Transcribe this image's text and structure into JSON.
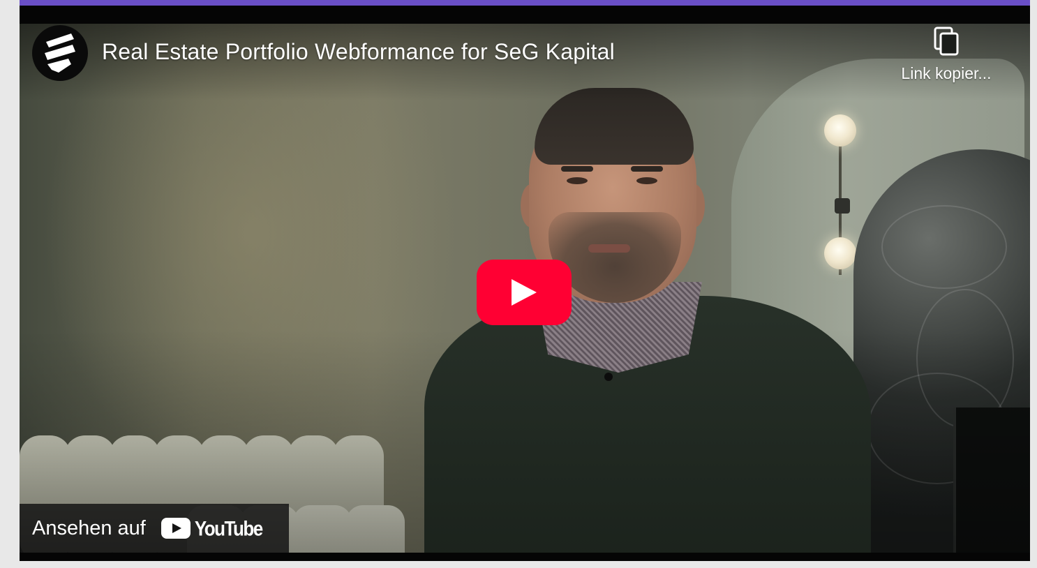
{
  "video": {
    "title": "Real Estate Portfolio Webformance for SeG Kapital",
    "channel_logo_icon": "channel-logo-icon",
    "copy_link_label": "Link kopier...",
    "copy_icon": "copy-icon",
    "play_icon": "play-icon",
    "watch_on_label": "Ansehen auf",
    "youtube_wordmark": "YouTube",
    "youtube_icon": "youtube-logo-icon"
  },
  "colors": {
    "accent_bar": "#6a4fc7",
    "play_button": "#ff0033",
    "overlay_text": "#ffffff",
    "page_background": "#e8e8e8"
  }
}
